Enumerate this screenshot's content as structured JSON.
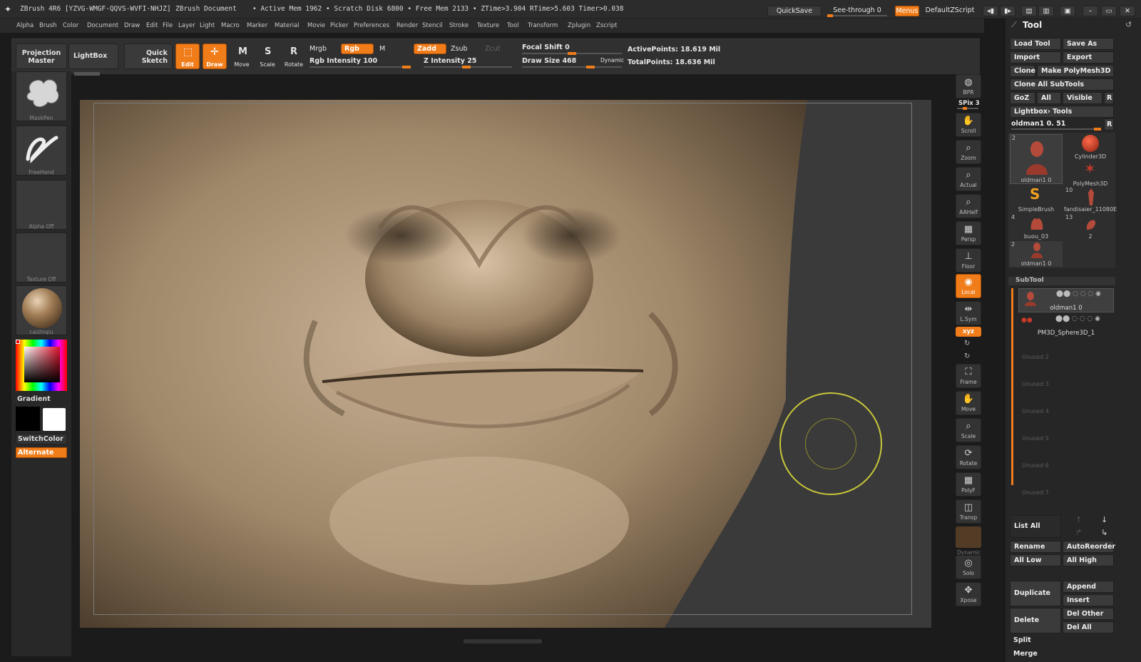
{
  "titlebar": {
    "app_title": "ZBrush 4R6 [YZVG-WMGF-QQVS-WVFI-NHJZ]",
    "document": "ZBrush Document",
    "stats": "• Active Mem 1962 • Scratch Disk 6800 • Free Mem 2133 • ZTime>3.904 RTime>5.603 Timer>0.038",
    "quicksave": "QuickSave",
    "seethrough": "See-through  0",
    "menus": "Menus",
    "defaultzscript": "DefaultZScript"
  },
  "menubar": [
    "Alpha",
    "Brush",
    "Color",
    "Document",
    "Draw",
    "Edit",
    "File",
    "Layer",
    "Light",
    "Macro",
    "Marker",
    "Material",
    "Movie",
    "Picker",
    "Preferences",
    "Render",
    "Stencil",
    "Stroke",
    "Texture",
    "Tool",
    "Transform",
    "Zplugin",
    "Zscript"
  ],
  "shelf": {
    "projection_master": "Projection Master",
    "lightbox": "LightBox",
    "quick_sketch": "Quick Sketch",
    "edit": "Edit",
    "draw": "Draw",
    "move": "Move",
    "scale": "Scale",
    "rotate": "Rotate",
    "mrgb": "Mrgb",
    "rgb": "Rgb",
    "m": "M",
    "zadd": "Zadd",
    "zsub": "Zsub",
    "zcut": "Zcut",
    "rgb_intensity": "Rgb Intensity 100",
    "z_intensity": "Z Intensity 25",
    "focal_shift": "Focal Shift 0",
    "draw_size": "Draw Size 468",
    "dynamic": "Dynamic",
    "active_points": "ActivePoints: 18.619 Mil",
    "total_points": "TotalPoints: 18.636 Mil"
  },
  "leftcol": {
    "brush_cap": "MaskPen",
    "stroke_cap": "FreeHand",
    "alpha_cap": "Alpha Off",
    "texture_cap": "Texture Off",
    "material_cap": "caizhiqiu",
    "gradient": "Gradient",
    "switchcolor": "SwitchColor",
    "alternate": "Alternate"
  },
  "rightstrip": [
    {
      "g": "◍",
      "c": "BPR"
    },
    {
      "g": "✋",
      "c": "Scroll"
    },
    {
      "g": "⌕",
      "c": "Zoom"
    },
    {
      "g": "⌕",
      "c": "Actual"
    },
    {
      "g": "⌕",
      "c": "AAHalf"
    },
    {
      "g": "▦",
      "c": "Persp"
    },
    {
      "g": "⊥",
      "c": "Floor"
    },
    {
      "g": "◉",
      "c": "Local"
    },
    {
      "g": "⇹",
      "c": "L.Sym"
    },
    {
      "g": "⛶",
      "c": "Frame"
    },
    {
      "g": "✋",
      "c": "Move"
    },
    {
      "g": "⌕",
      "c": "Scale"
    },
    {
      "g": "⟳",
      "c": "Rotate"
    },
    {
      "g": "▦",
      "c": "PolyF"
    },
    {
      "g": "◫",
      "c": "Transp"
    },
    {
      "g": "◎",
      "c": "Solo"
    },
    {
      "g": "✥",
      "c": "Xpose"
    }
  ],
  "rightstrip_extra": {
    "spix": "SPix 3",
    "xyz": "xyz",
    "dynamic": "Dynamic"
  },
  "tool_panel": {
    "title": "Tool",
    "load_tool": "Load Tool",
    "save_as": "Save As",
    "import": "Import",
    "export": "Export",
    "clone": "Clone",
    "make_polymesh": "Make PolyMesh3D",
    "clone_all": "Clone All SubTools",
    "goz": "GoZ",
    "all": "All",
    "visible": "Visible",
    "r": "R",
    "lightbox_tools": "Lightbox› Tools",
    "current_tool": "oldman1 0. 51",
    "thumbs": [
      {
        "num": "2",
        "cap": "oldman1 0"
      },
      {
        "num": "",
        "cap": "Cylinder3D"
      },
      {
        "num": "",
        "cap": "PolyMesh3D"
      },
      {
        "num": "",
        "cap": "SimpleBrush"
      },
      {
        "num": "10",
        "cap": "fandisaier_11080E"
      },
      {
        "num": "4",
        "cap": "buou_03"
      },
      {
        "num": "13",
        "cap": "2"
      },
      {
        "num": "2",
        "cap": "oldman1 0"
      }
    ],
    "subtool_header": "SubTool",
    "subtools": [
      "oldman1 0",
      "PM3D_Sphere3D_1"
    ],
    "unused": [
      "Unused 2",
      "Unused 3",
      "Unused 4",
      "Unused 5",
      "Unused 6",
      "Unused 7"
    ],
    "list_all": "List All",
    "rename": "Rename",
    "autoreorder": "AutoReorder",
    "all_low": "All Low",
    "all_high": "All High",
    "duplicate": "Duplicate",
    "append": "Append",
    "insert": "Insert",
    "delete": "Delete",
    "del_other": "Del Other",
    "del_all": "Del All",
    "split": "Split",
    "merge": "Merge"
  },
  "colors": {
    "accent": "#f07c1a",
    "cursor": "#c9c63a",
    "skin": "#a38a6e"
  }
}
